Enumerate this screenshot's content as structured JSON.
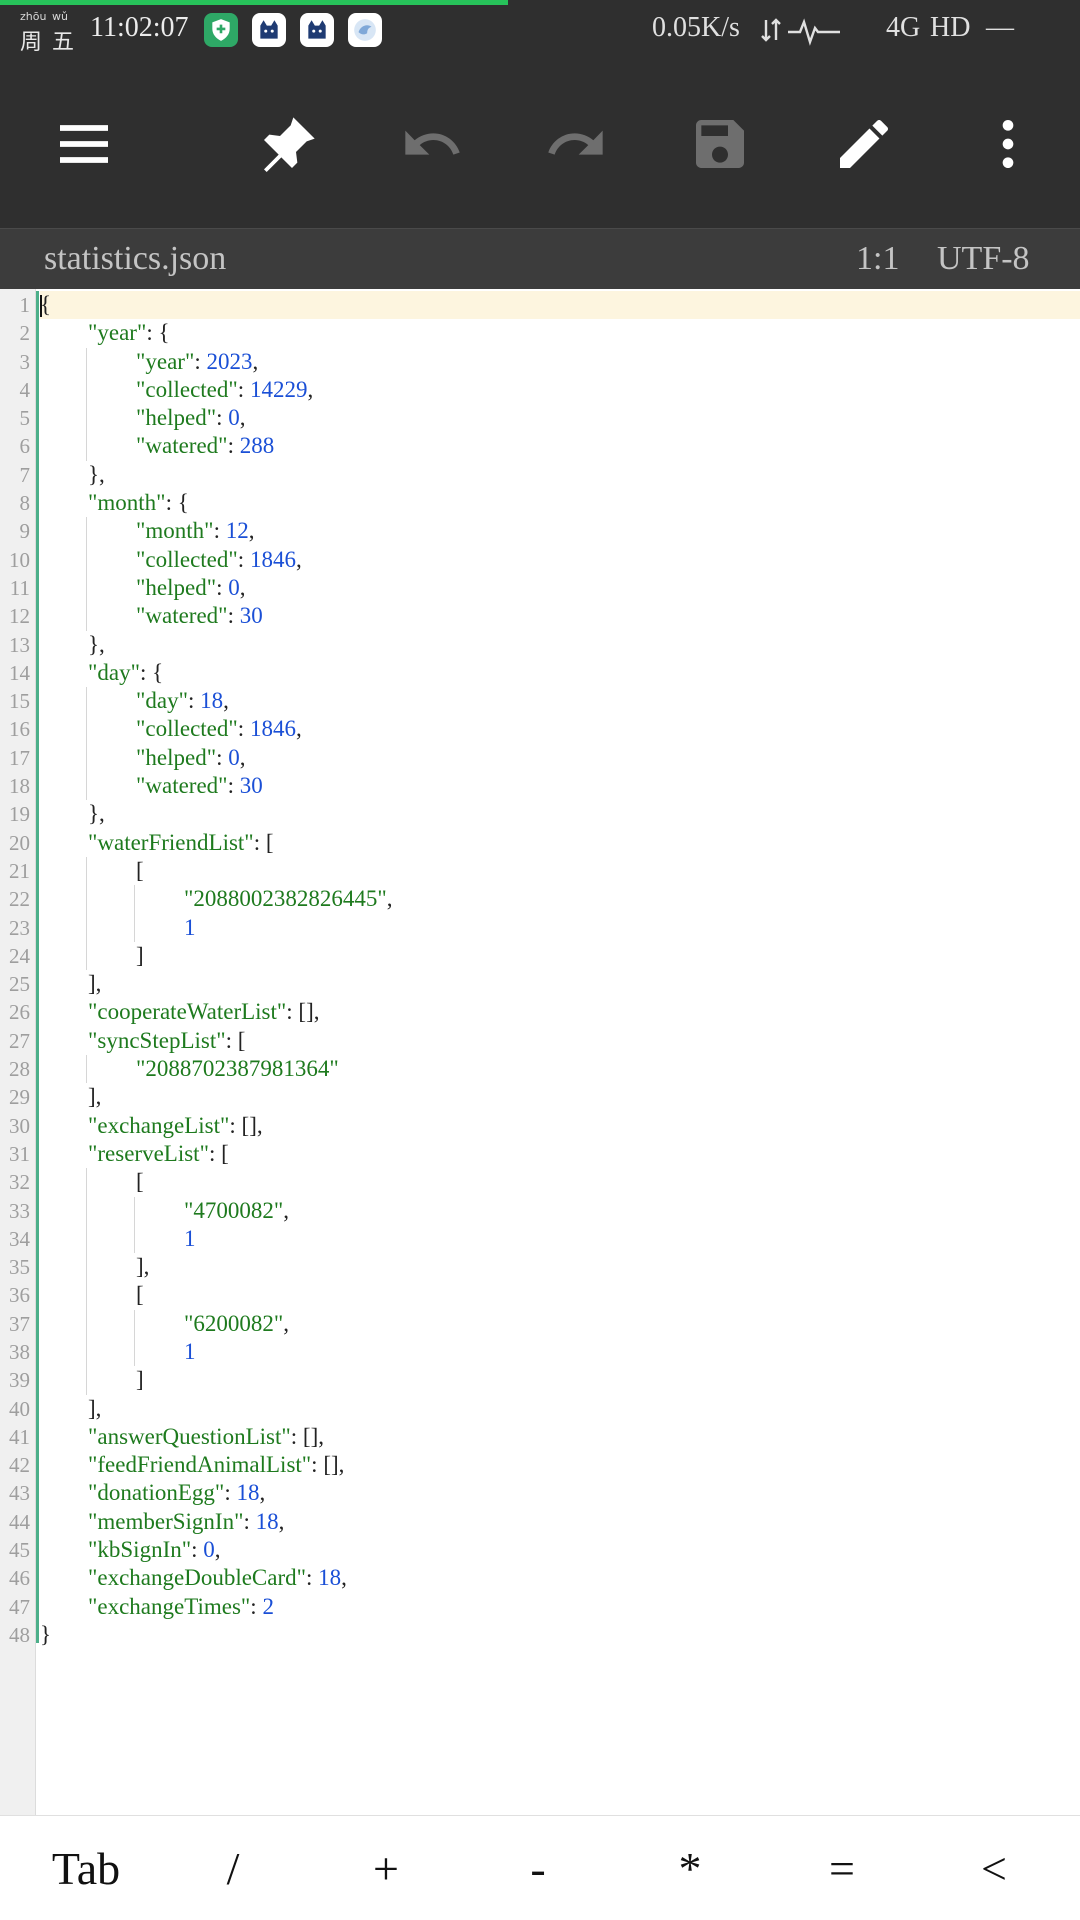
{
  "status_bar": {
    "weekday_pinyin_1": "zhōu",
    "weekday_pinyin_2": "wǔ",
    "weekday_char_1": "周",
    "weekday_char_2": "五",
    "time": "11:02:07",
    "app_icons": [
      "shield-app-icon",
      "cat-app-icon",
      "cat-app-icon",
      "bird-app-icon"
    ],
    "network_speed": "0.05K/s",
    "network_type": "4G",
    "hd_label": "HD",
    "trailing": "—",
    "progress_fraction": 0.47,
    "progress_color": "#27c25a"
  },
  "toolbar": {
    "buttons": [
      "menu",
      "pin",
      "undo",
      "redo",
      "save",
      "edit",
      "more"
    ]
  },
  "file_bar": {
    "file_name": "statistics.json",
    "cursor_position": "1:1",
    "encoding": "UTF-8"
  },
  "editor": {
    "current_line": 1,
    "lines": [
      {
        "n": 1,
        "indent": 0,
        "text": "{"
      },
      {
        "n": 2,
        "indent": 1,
        "text": "\"year\": {"
      },
      {
        "n": 3,
        "indent": 2,
        "text": "\"year\": 2023,"
      },
      {
        "n": 4,
        "indent": 2,
        "text": "\"collected\": 14229,"
      },
      {
        "n": 5,
        "indent": 2,
        "text": "\"helped\": 0,"
      },
      {
        "n": 6,
        "indent": 2,
        "text": "\"watered\": 288"
      },
      {
        "n": 7,
        "indent": 1,
        "text": "},"
      },
      {
        "n": 8,
        "indent": 1,
        "text": "\"month\": {"
      },
      {
        "n": 9,
        "indent": 2,
        "text": "\"month\": 12,"
      },
      {
        "n": 10,
        "indent": 2,
        "text": "\"collected\": 1846,"
      },
      {
        "n": 11,
        "indent": 2,
        "text": "\"helped\": 0,"
      },
      {
        "n": 12,
        "indent": 2,
        "text": "\"watered\": 30"
      },
      {
        "n": 13,
        "indent": 1,
        "text": "},"
      },
      {
        "n": 14,
        "indent": 1,
        "text": "\"day\": {"
      },
      {
        "n": 15,
        "indent": 2,
        "text": "\"day\": 18,"
      },
      {
        "n": 16,
        "indent": 2,
        "text": "\"collected\": 1846,"
      },
      {
        "n": 17,
        "indent": 2,
        "text": "\"helped\": 0,"
      },
      {
        "n": 18,
        "indent": 2,
        "text": "\"watered\": 30"
      },
      {
        "n": 19,
        "indent": 1,
        "text": "},"
      },
      {
        "n": 20,
        "indent": 1,
        "text": "\"waterFriendList\": ["
      },
      {
        "n": 21,
        "indent": 2,
        "text": "["
      },
      {
        "n": 22,
        "indent": 3,
        "text": "\"2088002382826445\","
      },
      {
        "n": 23,
        "indent": 3,
        "text": "1"
      },
      {
        "n": 24,
        "indent": 2,
        "text": "]"
      },
      {
        "n": 25,
        "indent": 1,
        "text": "],"
      },
      {
        "n": 26,
        "indent": 1,
        "text": "\"cooperateWaterList\": [],"
      },
      {
        "n": 27,
        "indent": 1,
        "text": "\"syncStepList\": ["
      },
      {
        "n": 28,
        "indent": 2,
        "text": "\"2088702387981364\""
      },
      {
        "n": 29,
        "indent": 1,
        "text": "],"
      },
      {
        "n": 30,
        "indent": 1,
        "text": "\"exchangeList\": [],"
      },
      {
        "n": 31,
        "indent": 1,
        "text": "\"reserveList\": ["
      },
      {
        "n": 32,
        "indent": 2,
        "text": "["
      },
      {
        "n": 33,
        "indent": 3,
        "text": "\"4700082\","
      },
      {
        "n": 34,
        "indent": 3,
        "text": "1"
      },
      {
        "n": 35,
        "indent": 2,
        "text": "],"
      },
      {
        "n": 36,
        "indent": 2,
        "text": "["
      },
      {
        "n": 37,
        "indent": 3,
        "text": "\"6200082\","
      },
      {
        "n": 38,
        "indent": 3,
        "text": "1"
      },
      {
        "n": 39,
        "indent": 2,
        "text": "]"
      },
      {
        "n": 40,
        "indent": 1,
        "text": "],"
      },
      {
        "n": 41,
        "indent": 1,
        "text": "\"answerQuestionList\": [],"
      },
      {
        "n": 42,
        "indent": 1,
        "text": "\"feedFriendAnimalList\": [],"
      },
      {
        "n": 43,
        "indent": 1,
        "text": "\"donationEgg\": 18,"
      },
      {
        "n": 44,
        "indent": 1,
        "text": "\"memberSignIn\": 18,"
      },
      {
        "n": 45,
        "indent": 1,
        "text": "\"kbSignIn\": 0,"
      },
      {
        "n": 46,
        "indent": 1,
        "text": "\"exchangeDoubleCard\": 18,"
      },
      {
        "n": 47,
        "indent": 1,
        "text": "\"exchangeTimes\": 2"
      },
      {
        "n": 48,
        "indent": 0,
        "text": "}"
      }
    ]
  },
  "symbol_bar": {
    "keys": [
      "Tab",
      "/",
      "+",
      "-",
      "*",
      "=",
      "<"
    ]
  },
  "colors": {
    "toolbar_bg": "#2f2f2f",
    "file_bar_bg": "#3c3c3c",
    "json_key": "#1e7a1e",
    "json_number": "#1a4fd6",
    "current_line_highlight": "#fdf5df"
  }
}
